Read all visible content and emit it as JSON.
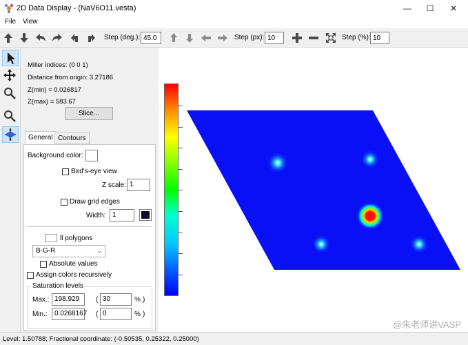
{
  "window": {
    "title": "2D Data Display - (NaV6O11.vesta)",
    "minimize": "—",
    "maximize": "☐",
    "close": "✕"
  },
  "menu": {
    "file": "File",
    "view": "View"
  },
  "toolbar": {
    "step_deg_label": "Step (deg.):",
    "step_deg_value": "45.0",
    "step_px_label": "Step (px):",
    "step_px_value": "10",
    "step_pct_label": "Step (%):",
    "step_pct_value": "10"
  },
  "info": {
    "miller": "Miller indices: (0 0 1)",
    "distance": "Distance from origin: 3.27186",
    "zmin": "Z(min) = 0.026817",
    "zmax": "Z(max) = 583.67",
    "slice_button": "Slice..."
  },
  "tabs": {
    "general": "General",
    "contours": "Contours"
  },
  "general": {
    "bg_color_label": "Background color:",
    "birds_eye_label": "Bird's-eye view",
    "zscale_label": "Z scale:",
    "zscale_value": "1",
    "draw_grid_label": "Draw grid edges",
    "width_label": "Width:",
    "width_value": "1",
    "fill_polygons_label": "ll polygons",
    "colormap_value": "B-G-R",
    "absolute_values_label": "Absolute values",
    "assign_colors_label": "Assign colors recursively",
    "saturation_title": "Saturation levels",
    "max_label": "Max.:",
    "max_value": "198.929",
    "max_pct": "30",
    "min_label": "Min.:",
    "min_value": "0.0268167",
    "min_pct": "0",
    "paren": "(",
    "pct": "%",
    "pct_close": ")"
  },
  "status": {
    "text": "Level: 1.50788;   Fractional coordinate: (-0.50535, 0.25322, 0.25000)"
  },
  "watermark": "@朱老师讲VASP",
  "colors": {
    "plane": "#0000ff",
    "hotspot_center": "#ff0000",
    "spot_glow": "#00ccff"
  }
}
